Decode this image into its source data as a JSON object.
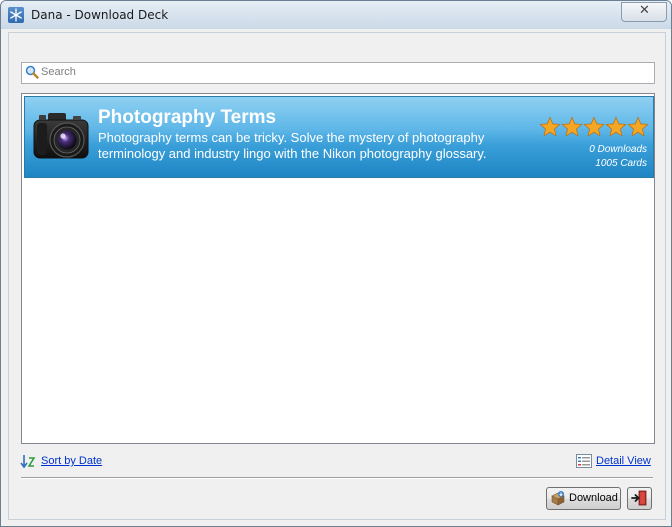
{
  "window": {
    "title": "Dana - Download Deck",
    "close_glyph": "✕",
    "app_icon": "snowflake-icon"
  },
  "search": {
    "placeholder": "Search",
    "value": "",
    "icon": "search-icon"
  },
  "decks": [
    {
      "title": "Photography Terms",
      "description": "Photography terms can be tricky. Solve the mystery of photography terminology and industry lingo with the Nikon photography glossary.",
      "rating": 5,
      "rating_max": 5,
      "downloads": "0 Downloads",
      "cards": "1005 Cards",
      "icon": "camera-icon"
    }
  ],
  "footer": {
    "sort_label": "Sort by Date",
    "detail_label": "Detail View",
    "download_label": "Download"
  },
  "colors": {
    "deck_highlight": "#3a9fd9",
    "link": "#0033cc",
    "star": "#f5a623"
  }
}
